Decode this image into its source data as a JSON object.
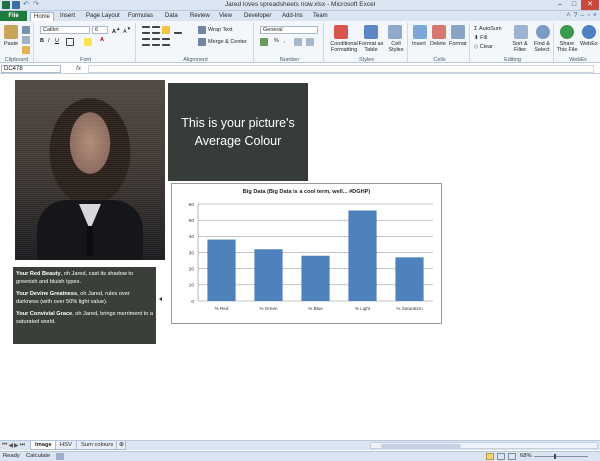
{
  "window": {
    "title": "Jared loves spreadsheets now.xlsx - Microsoft Excel"
  },
  "tabs": [
    {
      "label": "File",
      "kind": "file"
    },
    {
      "label": "Home",
      "active": true
    },
    {
      "label": "Insert"
    },
    {
      "label": "Page Layout"
    },
    {
      "label": "Formulas"
    },
    {
      "label": "Data"
    },
    {
      "label": "Review"
    },
    {
      "label": "View"
    },
    {
      "label": "Developer"
    },
    {
      "label": "Add-Ins"
    },
    {
      "label": "Team"
    }
  ],
  "ribbon": {
    "clipboard": {
      "label": "Clipboard",
      "paste": "Paste"
    },
    "font": {
      "label": "Font",
      "name": "Calibri",
      "size": "6"
    },
    "alignment": {
      "label": "Alignment",
      "wrap": "Wrap Text",
      "merge": "Merge & Center"
    },
    "number": {
      "label": "Number",
      "format": "General",
      "pct": "%",
      "comma": ","
    },
    "styles": {
      "label": "Styles",
      "conditional": "Conditional Formatting",
      "format_table": "Format as Table",
      "cell_styles": "Cell Styles"
    },
    "cells": {
      "label": "Cells",
      "insert": "Insert",
      "delete": "Delete",
      "format": "Format"
    },
    "editing": {
      "label": "Editing",
      "autosum": "AutoSum",
      "fill": "Fill",
      "clear": "Clear",
      "sort": "Sort & Filter",
      "find": "Find & Select"
    },
    "webex": {
      "label": "WebEx",
      "share": "Share This File",
      "webex": "WebEx"
    }
  },
  "formula_bar": {
    "name_box": "DC478",
    "fx": "fx",
    "formula": ""
  },
  "sheet": {
    "avg_box_text": "This is your picture's Average Colour",
    "description": [
      {
        "bold": "Your Red Beauty",
        "rest": ", oh Jared, cast its shadow to greenish and bluish types."
      },
      {
        "bold": "Your Devine Greatness",
        "rest": ", oh Jared, rules over darkness (with over 50% light value)."
      },
      {
        "bold": "Your Convivial Grace",
        "rest": ", oh Jared, brings merriment to a saturated world."
      }
    ]
  },
  "chart_data": {
    "type": "bar",
    "title": "Big Data (Big Data is a cool term, well... #DGHP)",
    "categories": [
      "% Red",
      "% Green",
      "% Blue",
      "% Light",
      "% Saturation"
    ],
    "values": [
      38,
      32,
      28,
      56,
      27
    ],
    "ylim": [
      0,
      60
    ],
    "yticks": [
      0,
      10,
      20,
      30,
      40,
      50,
      60
    ],
    "bar_color": "#4f81bd",
    "grid": true,
    "legend": "none"
  },
  "sheet_tabs": [
    {
      "label": "Image",
      "active": true
    },
    {
      "label": "HSV"
    },
    {
      "label": "Sum colours"
    }
  ],
  "status": {
    "ready": "Ready",
    "calculate": "Calculate",
    "zoom": "68%"
  },
  "colors": {
    "file_tab": "#1f7a3d",
    "ribbon_bg": "#f3f6fb",
    "avg_box": "#363d39",
    "desc_box": "#3a4039"
  }
}
